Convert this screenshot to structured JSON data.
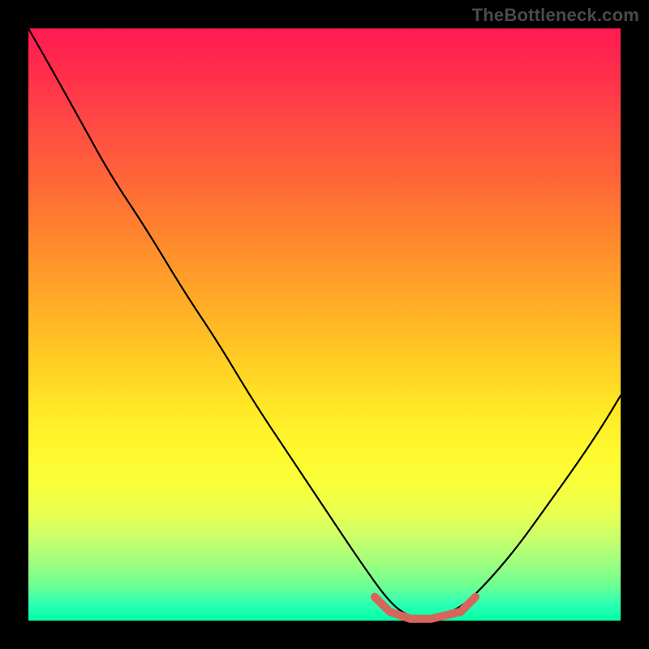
{
  "watermark": "TheBottleneck.com",
  "chart_data": {
    "type": "line",
    "title": "",
    "xlabel": "",
    "ylabel": "",
    "x": [
      0.0,
      0.04,
      0.09,
      0.14,
      0.2,
      0.26,
      0.32,
      0.38,
      0.44,
      0.5,
      0.56,
      0.61,
      0.645,
      0.68,
      0.73,
      0.78,
      0.83,
      0.88,
      0.93,
      0.97,
      1.0
    ],
    "y": [
      1.0,
      0.93,
      0.84,
      0.75,
      0.66,
      0.56,
      0.47,
      0.37,
      0.28,
      0.19,
      0.1,
      0.03,
      0.005,
      0.005,
      0.02,
      0.07,
      0.13,
      0.2,
      0.27,
      0.33,
      0.38
    ],
    "xlim": [
      0,
      1
    ],
    "ylim": [
      0,
      1
    ],
    "highlight_segment": {
      "x": [
        0.585,
        0.61,
        0.645,
        0.68,
        0.73,
        0.755
      ],
      "y": [
        0.04,
        0.015,
        0.003,
        0.003,
        0.015,
        0.04
      ]
    },
    "background_gradient": {
      "direction": "top-to-bottom",
      "stops": [
        {
          "pos": 0.0,
          "color": "#ff1a52"
        },
        {
          "pos": 0.5,
          "color": "#ffd024"
        },
        {
          "pos": 0.8,
          "color": "#f0ff40"
        },
        {
          "pos": 1.0,
          "color": "#00ffa6"
        }
      ]
    }
  }
}
